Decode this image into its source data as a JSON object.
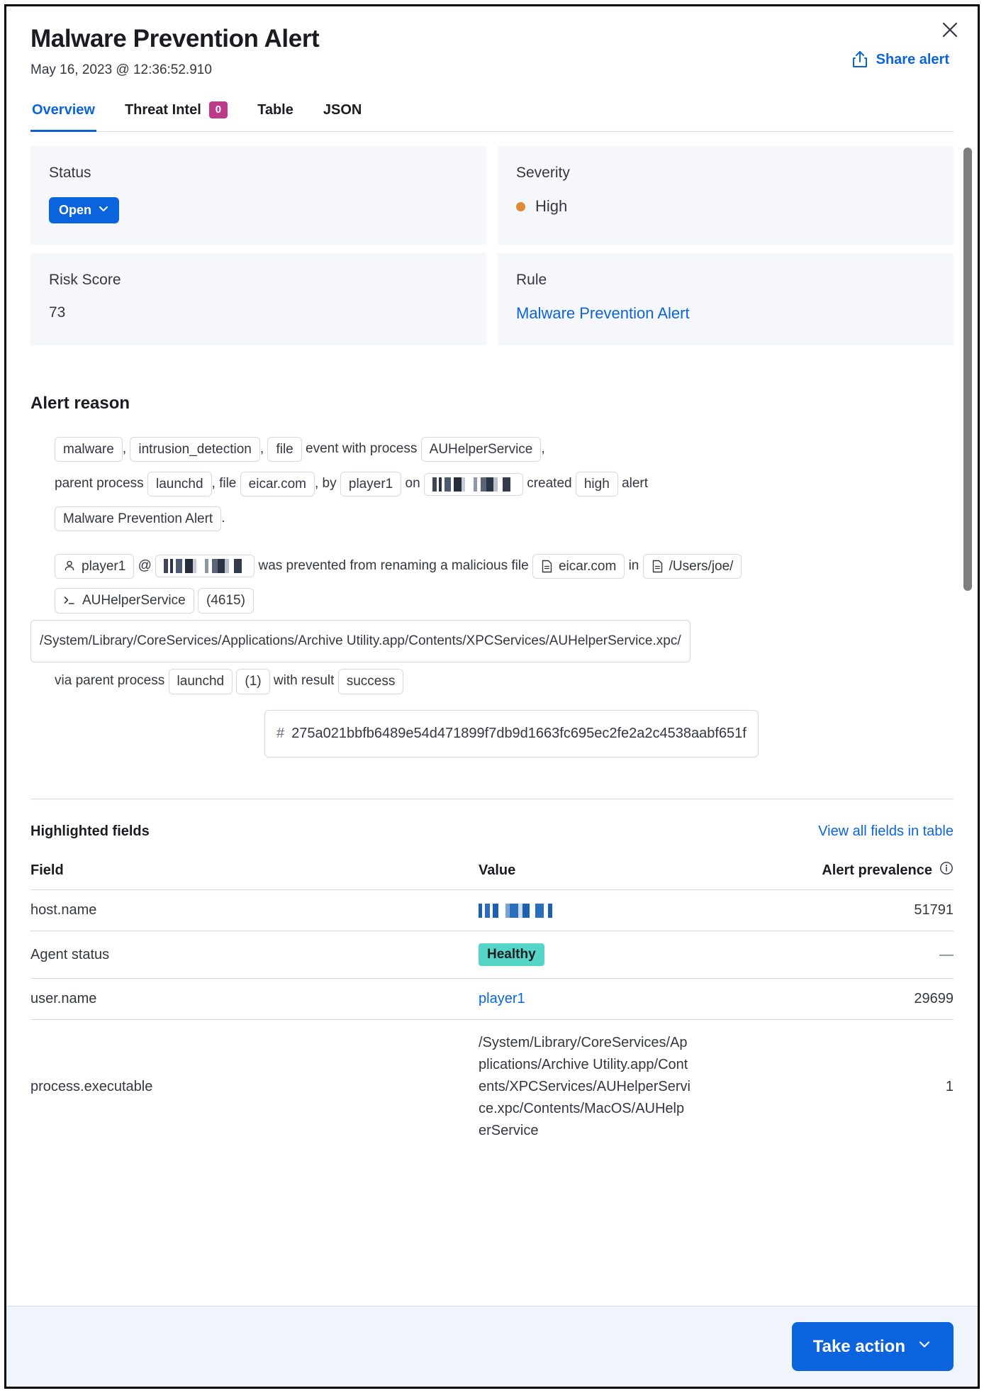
{
  "header": {
    "title": "Malware Prevention Alert",
    "timestamp": "May 16, 2023 @ 12:36:52.910",
    "share_label": "Share alert",
    "share_icon": "share-icon",
    "close_icon": "close-icon"
  },
  "tabs": [
    {
      "label": "Overview",
      "active": true,
      "badge": null
    },
    {
      "label": "Threat Intel",
      "active": false,
      "badge": "0"
    },
    {
      "label": "Table",
      "active": false,
      "badge": null
    },
    {
      "label": "JSON",
      "active": false,
      "badge": null
    }
  ],
  "cards": {
    "status": {
      "label": "Status",
      "value": "Open",
      "chevron_icon": "chevron-down-icon"
    },
    "severity": {
      "label": "Severity",
      "value": "High",
      "dot_color": "#e08a34"
    },
    "risk_score": {
      "label": "Risk Score",
      "value": "73"
    },
    "rule": {
      "label": "Rule",
      "value": "Malware Prevention Alert"
    }
  },
  "alert_reason": {
    "section_title": "Alert reason",
    "line1": {
      "chip_malware": "malware",
      "sep1": ",",
      "chip_intrusion": "intrusion_detection",
      "sep2": ",",
      "chip_file": "file",
      "text1": "event with process",
      "chip_process": "AUHelperService",
      "sep3": ","
    },
    "line2": {
      "text_parent": "parent process",
      "chip_launchd": "launchd",
      "sep1": ", file",
      "chip_eicar": "eicar.com",
      "sep2": ", by",
      "chip_user": "player1",
      "text_on": "on",
      "chip_host": "[redacted]",
      "text_created": "created",
      "chip_high": "high",
      "text_alert": "alert"
    },
    "line3": {
      "chip_rule": "Malware Prevention Alert",
      "period": "."
    },
    "line4": {
      "chip_user": "player1",
      "user_icon": "user-icon",
      "at": "@",
      "chip_host": "[redacted]",
      "text1": "was prevented from renaming a malicious file",
      "chip_file": "eicar.com",
      "file_icon": "document-icon",
      "text_in": "in",
      "chip_dir": "/Users/joe/",
      "dir_icon": "document-icon"
    },
    "line5": {
      "chip_process": "AUHelperService",
      "console_icon": "console-icon",
      "chip_pid": "(4615)"
    },
    "line6": {
      "chip_path": "/System/Library/CoreServices/Applications/Archive Utility.app/Contents/XPCServices/AUHelperService.xpc/"
    },
    "line7": {
      "text_via": "via parent process",
      "chip_launchd": "launchd",
      "chip_pid": "(1)",
      "text_result": "with result",
      "chip_result": "success"
    },
    "hash": {
      "symbol": "#",
      "value": "275a021bbfb6489e54d471899f7db9d1663fc695ec2fe2a2c4538aabf651f"
    }
  },
  "highlighted_fields": {
    "title": "Highlighted fields",
    "view_all_label": "View all fields in table",
    "columns": {
      "field": "Field",
      "value": "Value",
      "prevalence": "Alert prevalence",
      "prevalence_info_icon": "info-icon"
    },
    "rows": [
      {
        "field": "host.name",
        "value": "[redacted]",
        "value_type": "redacted",
        "prevalence": "51791"
      },
      {
        "field": "Agent status",
        "value": "Healthy",
        "value_type": "badge",
        "prevalence": "—"
      },
      {
        "field": "user.name",
        "value": "player1",
        "value_type": "link",
        "prevalence": "29699"
      },
      {
        "field": "process.executable",
        "value": "/System/Library/CoreServices/Applications/Archive Utility.app/Contents/XPCServices/AUHelperService.xpc/Contents/MacOS/AUHelperService",
        "value_type": "text",
        "prevalence": "1"
      }
    ]
  },
  "footer": {
    "take_action_label": "Take action",
    "chevron_icon": "chevron-down-icon"
  },
  "colors": {
    "accent_blue": "#0b64dd",
    "badge_pink": "#bd3989",
    "healthy_teal": "#54d5c8",
    "severity_orange": "#e08a34",
    "card_bg": "#f5f7fa"
  }
}
